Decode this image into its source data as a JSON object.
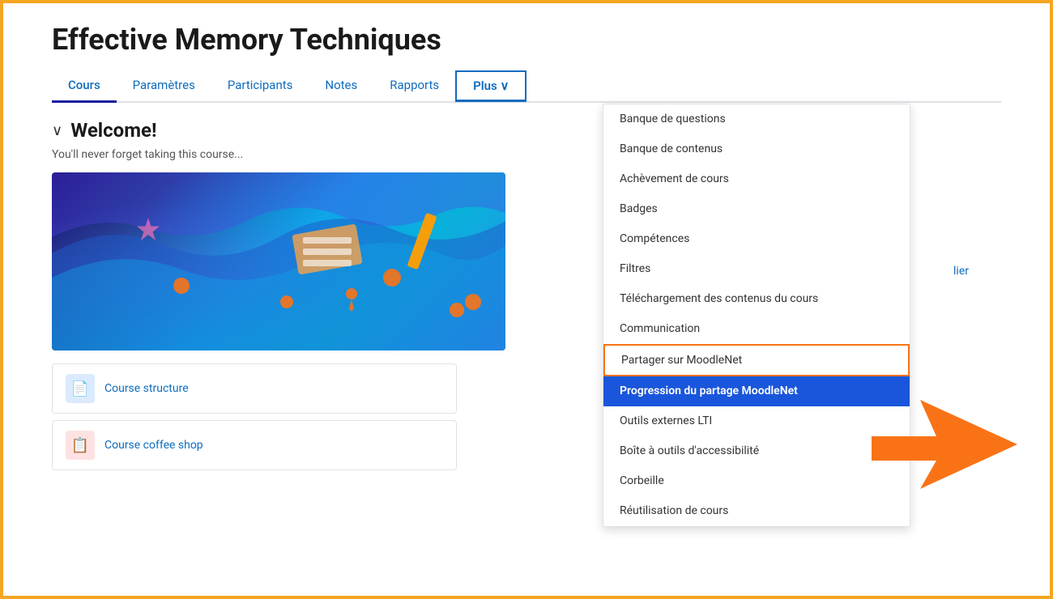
{
  "page": {
    "title": "Effective Memory Techniques",
    "outer_border_color": "#f5a623"
  },
  "tabs": [
    {
      "id": "cours",
      "label": "Cours",
      "active": true,
      "blue": false
    },
    {
      "id": "parametres",
      "label": "Paramètres",
      "active": false,
      "blue": true
    },
    {
      "id": "participants",
      "label": "Participants",
      "active": false,
      "blue": true
    },
    {
      "id": "notes",
      "label": "Notes",
      "active": false,
      "blue": true
    },
    {
      "id": "rapports",
      "label": "Rapports",
      "active": false,
      "blue": true
    },
    {
      "id": "plus",
      "label": "Plus ∨",
      "active": false,
      "highlighted": true,
      "blue": true
    }
  ],
  "welcome": {
    "title": "Welcome!",
    "text": "You'll never forget taking this course..."
  },
  "dropdown": {
    "items": [
      {
        "id": "banque-questions",
        "label": "Banque de questions",
        "selected": false,
        "outlined": false
      },
      {
        "id": "banque-contenus",
        "label": "Banque de contenus",
        "selected": false,
        "outlined": false
      },
      {
        "id": "achevement-cours",
        "label": "Achèvement de cours",
        "selected": false,
        "outlined": false
      },
      {
        "id": "badges",
        "label": "Badges",
        "selected": false,
        "outlined": false
      },
      {
        "id": "competences",
        "label": "Compétences",
        "selected": false,
        "outlined": false
      },
      {
        "id": "filtres",
        "label": "Filtres",
        "selected": false,
        "outlined": false
      },
      {
        "id": "telechargement",
        "label": "Téléchargement des contenus du cours",
        "selected": false,
        "outlined": false
      },
      {
        "id": "communication",
        "label": "Communication",
        "selected": false,
        "outlined": false
      },
      {
        "id": "partager-moodlenet",
        "label": "Partager sur MoodleNet",
        "selected": false,
        "outlined": true
      },
      {
        "id": "progression-moodlenet",
        "label": "Progression du partage MoodleNet",
        "selected": true,
        "outlined": false
      },
      {
        "id": "outils-externes",
        "label": "Outils externes LTI",
        "selected": false,
        "outlined": false
      },
      {
        "id": "boite-accessibilite",
        "label": "Boîte à outils d'accessibilité",
        "selected": false,
        "outlined": false
      },
      {
        "id": "corbeille",
        "label": "Corbeille",
        "selected": false,
        "outlined": false
      },
      {
        "id": "reutilisation",
        "label": "Réutilisation de cours",
        "selected": false,
        "outlined": false
      }
    ]
  },
  "course_items": [
    {
      "id": "course-structure",
      "label": "Course structure",
      "icon": "📄",
      "icon_class": "icon-blue"
    },
    {
      "id": "course-coffee",
      "label": "Course coffee shop",
      "icon": "📋",
      "icon_class": "icon-red"
    }
  ],
  "right_link": {
    "label": "lier"
  }
}
